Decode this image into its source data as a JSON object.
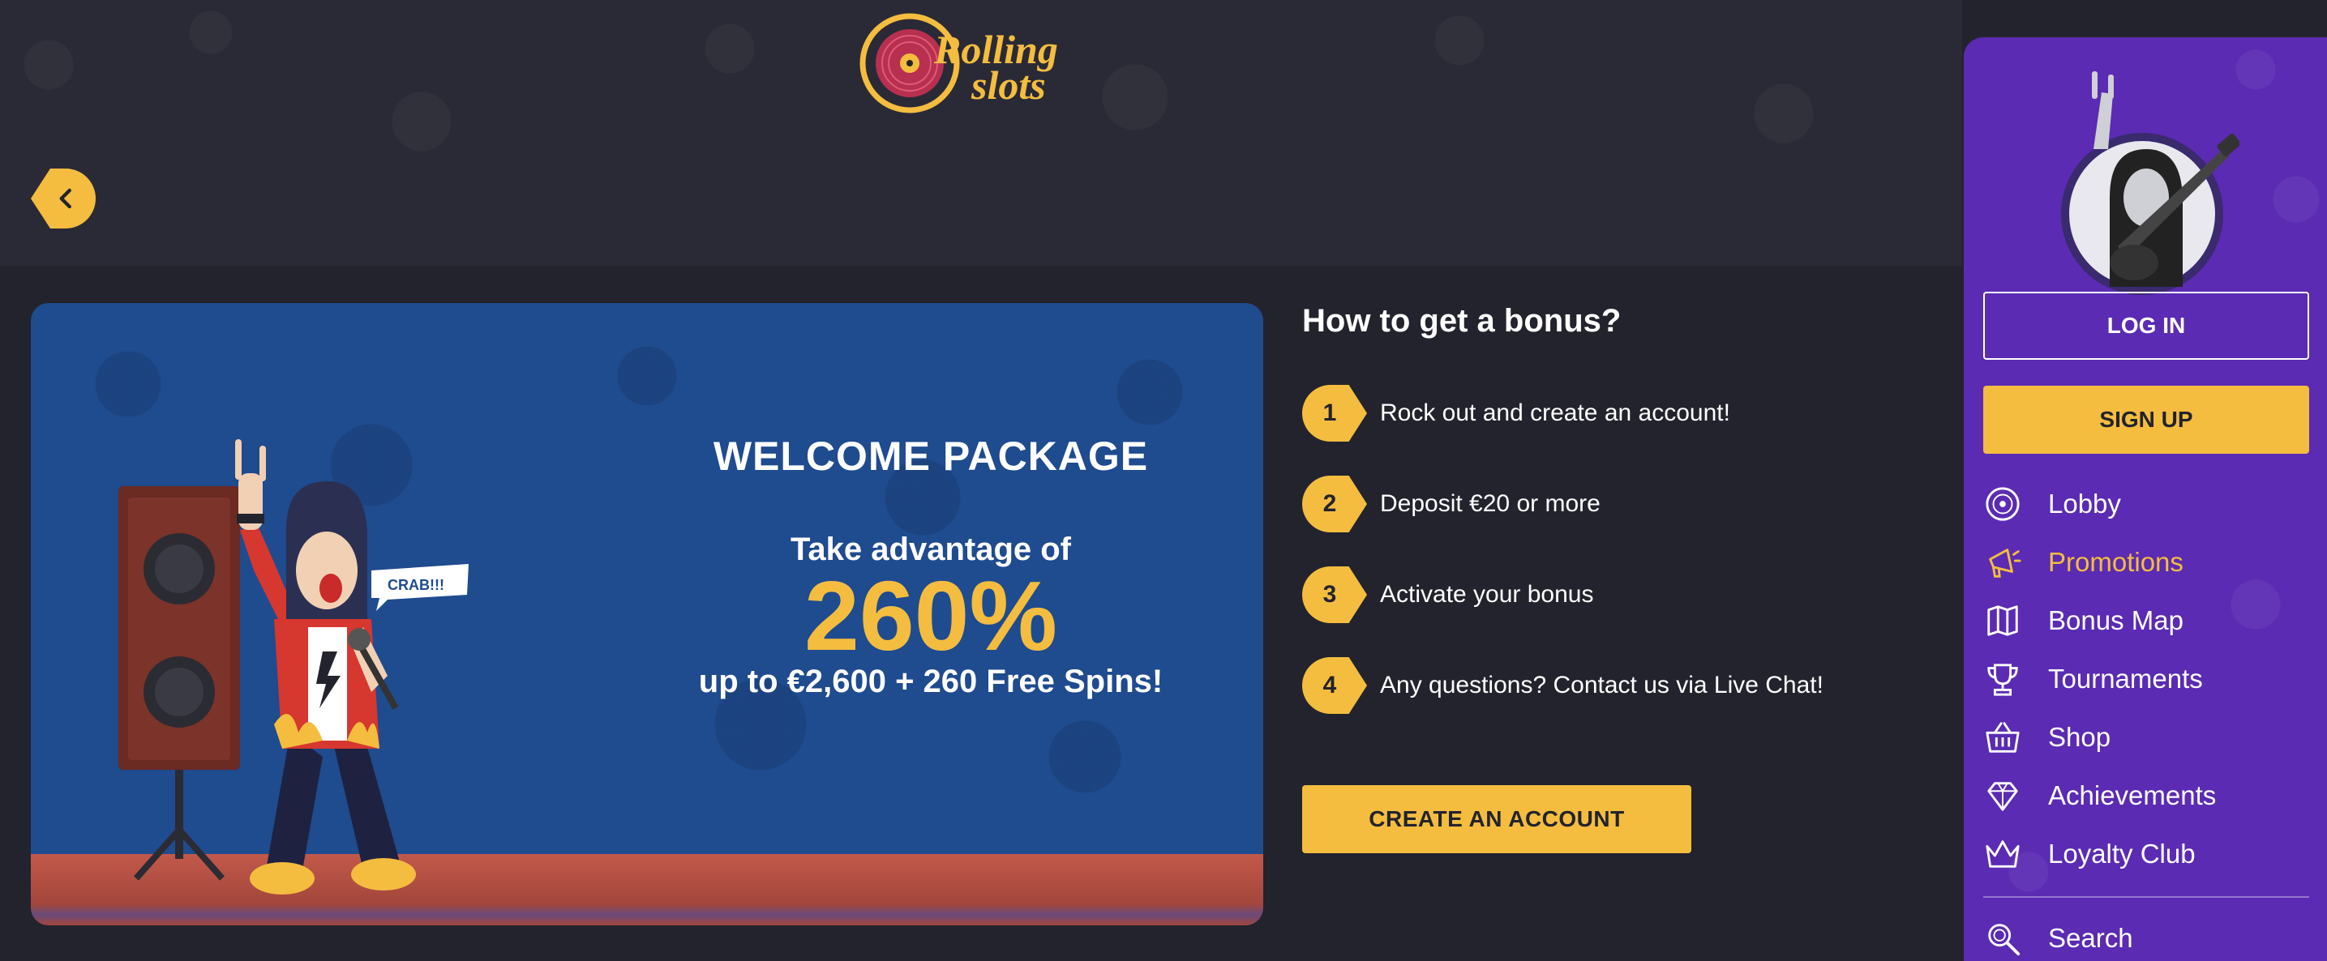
{
  "header": {
    "logo_text_line1": "Rolling",
    "logo_text_line2": "slots"
  },
  "banner": {
    "speech_bubble": "CRAB!!!",
    "title": "WELCOME PACKAGE",
    "take_advantage": "Take advantage of",
    "percent": "260%",
    "offer": "up to €2,600 + 260 Free Spins!"
  },
  "bonus": {
    "title": "How to get a bonus?",
    "steps": [
      {
        "num": "1",
        "text": "Rock out and create an account!"
      },
      {
        "num": "2",
        "text": "Deposit €20 or more"
      },
      {
        "num": "3",
        "text": "Activate your bonus"
      },
      {
        "num": "4",
        "text": "Any questions? Contact us via Live Chat!"
      }
    ],
    "cta": "CREATE AN ACCOUNT"
  },
  "sidebar": {
    "login": "LOG IN",
    "signup": "SIGN UP",
    "nav": [
      {
        "label": "Lobby",
        "icon": "vinyl-record-icon",
        "active": false
      },
      {
        "label": "Promotions",
        "icon": "megaphone-icon",
        "active": true
      },
      {
        "label": "Bonus Map",
        "icon": "map-icon",
        "active": false
      },
      {
        "label": "Tournaments",
        "icon": "trophy-icon",
        "active": false
      },
      {
        "label": "Shop",
        "icon": "basket-icon",
        "active": false
      },
      {
        "label": "Achievements",
        "icon": "diamond-icon",
        "active": false
      },
      {
        "label": "Loyalty Club",
        "icon": "crown-icon",
        "active": false
      }
    ],
    "search": {
      "label": "Search",
      "icon": "search-icon"
    }
  },
  "colors": {
    "background": "#23232e",
    "accent": "#f4bd3f",
    "sidebar": "#5b2bb3",
    "banner": "#1f4b8f"
  }
}
